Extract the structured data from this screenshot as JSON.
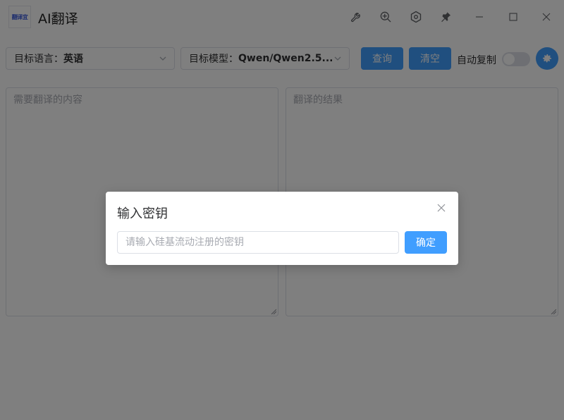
{
  "window": {
    "logo_text": "翻译宜",
    "title": "AI翻译",
    "icons": [
      "wrench-icon",
      "zoom-in-icon",
      "hexagon-settings-icon",
      "pin-icon",
      "minimize-icon",
      "maximize-icon",
      "close-icon"
    ]
  },
  "toolbar": {
    "language_label": "目标语言：",
    "language_value": "英语",
    "model_label": "目标模型：",
    "model_value": "Qwen/Qwen2.5...",
    "query_label": "查询",
    "clear_label": "清空",
    "autocopy_label": "自动复制",
    "autocopy_on": false
  },
  "editor": {
    "input_placeholder": "需要翻译的内容",
    "output_placeholder": "翻译的结果"
  },
  "dialog": {
    "title": "输入密钥",
    "input_placeholder": "请输入硅基流动注册的密钥",
    "confirm_label": "确定"
  },
  "colors": {
    "primary": "#409eff",
    "overlay": "rgba(0,0,0,0.5)"
  }
}
